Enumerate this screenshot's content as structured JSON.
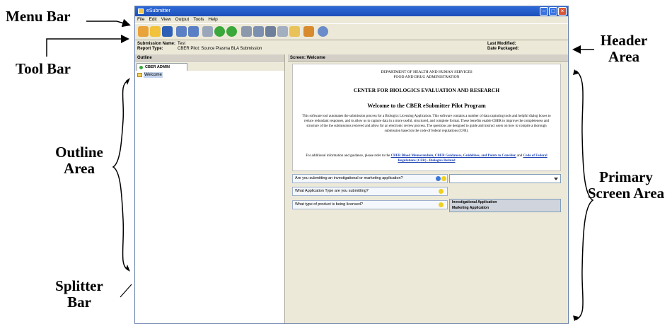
{
  "annotations": {
    "menu_bar": "Menu Bar",
    "tool_bar": "Tool Bar",
    "header_area": "Header Area",
    "outline_area": "Outline Area",
    "primary_screen_area": "Primary Screen Area",
    "splitter_bar": "Splitter Bar"
  },
  "window": {
    "title": "eSubmitter"
  },
  "menu": [
    "File",
    "Edit",
    "View",
    "Output",
    "Tools",
    "Help"
  ],
  "header": {
    "submission_name_label": "Submission Name:",
    "submission_name_value": "Test",
    "report_type_label": "Report Type:",
    "report_type_value": "CBER Pilot: Source Plasma BLA Submission",
    "last_modified_label": "Last Modified:",
    "date_packaged_label": "Date Packaged:"
  },
  "outline": {
    "title": "Outline",
    "tab": "CBER ADMIN",
    "tree_item": "Welcome"
  },
  "screen": {
    "title": "Screen: Welcome",
    "dept_line1": "DEPARTMENT OF HEALTH AND HUMAN SERVICES",
    "dept_line2": "FOOD AND DRUG ADMINISTRATION",
    "center": "CENTER FOR BIOLOGICS EVALUATION AND RESEARCH",
    "welcome_heading": "Welcome to the CBER eSubmitter Pilot Program",
    "para1": "This software tool automates the submission process for a Biologics Licensing Application. This software contains a number of data capturing tools and helpful dialog boxes to reduce redundant responses, and to allow us to capture data in a more useful, structured, and complete format. These benefits enable CBER to improve the completeness and structure of the the submissions recieved and allow for an electronic review process. The questions are designed to guide and instruct users on how to compile a thorough submission based on the code of federal regulations (CFR).",
    "para2_prefix": "For additional information and guidance, please refer to the",
    "link1": "CBER Blood Memorandum, CBER Guidances, Guidelines, and Points to Consider,",
    "para2_and": "and",
    "link2": "Code of Federal Regulations (CFR) - Biologics Related",
    "q1": "Are you submitting an investigational or marketing application?",
    "q2": "What Application Type are you submitting?",
    "q3": "What type of product is being licensed?",
    "options": [
      "Investigational Application",
      "Marketing Application"
    ]
  },
  "colors": {
    "titlebar": "#1c4fb8",
    "link": "#1a3fb0",
    "panel_bg": "#ece9d8"
  }
}
